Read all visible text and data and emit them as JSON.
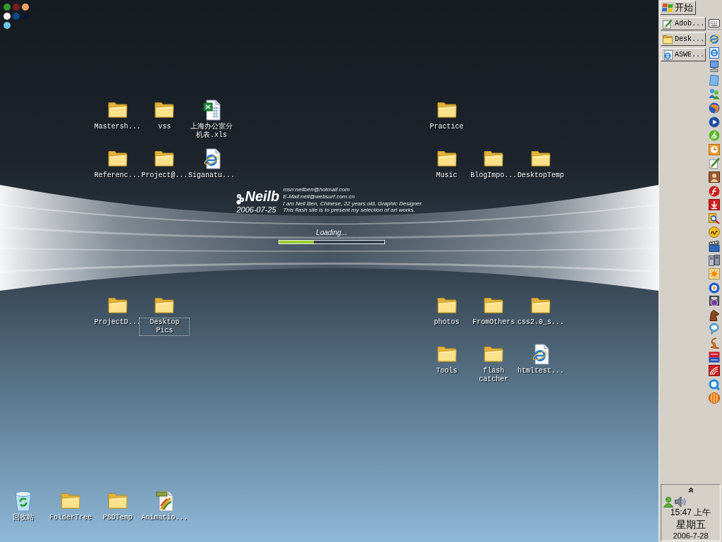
{
  "color_dots": [
    {
      "color": "#2e9b2b"
    },
    {
      "color": "#7a1d1d"
    },
    {
      "color": "#f0a262"
    },
    {
      "color": "#ffffff"
    },
    {
      "color": "#0b4c83"
    },
    {
      "color": "#0a1932"
    },
    {
      "color": "#6ec5e9"
    }
  ],
  "icon_groups": [
    {
      "rows": [
        [
          {
            "kind": "folder",
            "label": "Mastersh...",
            "focused": false
          },
          {
            "kind": "folder",
            "label": "vss",
            "focused": false
          },
          {
            "kind": "spreadsheet",
            "label": "上海办公室分机表.xls",
            "focused": false
          }
        ],
        [
          {
            "kind": "folder",
            "label": "Referenc...",
            "focused": false
          },
          {
            "kind": "folder",
            "label": "Project@...",
            "focused": false
          },
          {
            "kind": "web_page",
            "label": "Siganatu...",
            "focused": false
          }
        ]
      ]
    },
    {
      "rows": [
        [
          {
            "kind": "folder",
            "label": "Practice",
            "focused": false
          }
        ],
        [
          {
            "kind": "folder",
            "label": "Music",
            "focused": false
          },
          {
            "kind": "folder",
            "label": "BlogImpo...",
            "focused": false
          },
          {
            "kind": "folder",
            "label": "DesktopTemp",
            "focused": false
          }
        ]
      ]
    },
    {
      "rows": [
        [
          {
            "kind": "folder",
            "label": "ProjectD...",
            "focused": false
          },
          {
            "kind": "folder",
            "label": "Desktop Pics",
            "focused": true
          }
        ]
      ]
    },
    {
      "rows": [
        [
          {
            "kind": "folder",
            "label": "photos",
            "focused": false
          },
          {
            "kind": "folder",
            "label": "FromOthers",
            "focused": false
          },
          {
            "kind": "folder",
            "label": "css2.0_s...",
            "focused": false
          }
        ],
        [
          {
            "kind": "folder",
            "label": "Tools",
            "focused": false
          },
          {
            "kind": "folder",
            "label": "flash catcher",
            "focused": false
          },
          {
            "kind": "web_page",
            "label": "htmltest...",
            "focused": false
          }
        ]
      ]
    },
    {
      "rows": [
        [
          {
            "kind": "recycle_bin",
            "label": "回收站",
            "focused": false
          },
          {
            "kind": "folder",
            "label": "FolderTree",
            "focused": false
          },
          {
            "kind": "folder",
            "label": "PSDTemp",
            "focused": false
          },
          {
            "kind": "psd_file",
            "label": "Animatio...",
            "focused": false
          }
        ]
      ]
    }
  ],
  "flash_intro": {
    "logo": "Neilb",
    "date": "2006-07-25",
    "lines": [
      "msn:neilben@hotmail.com",
      "E-Mail:neil@websurf.com.cn",
      "I am Neil Ben, Chinese, 22 years old, Graphic Designer.",
      "This flash site is to present my selection of art works."
    ],
    "loading": {
      "label": "Loading...",
      "level": 0.33
    }
  },
  "taskbar": {
    "start": {
      "label": "开始"
    },
    "tasks": [
      {
        "kind": "pen_document",
        "label": "Adob..."
      },
      {
        "kind": "folder",
        "label": "Desk..."
      },
      {
        "kind": "web_page",
        "label": "ASWE..."
      }
    ],
    "clock": {
      "time": "15:47 上午",
      "weekday": "星期五",
      "date": "2006-7-28"
    }
  }
}
